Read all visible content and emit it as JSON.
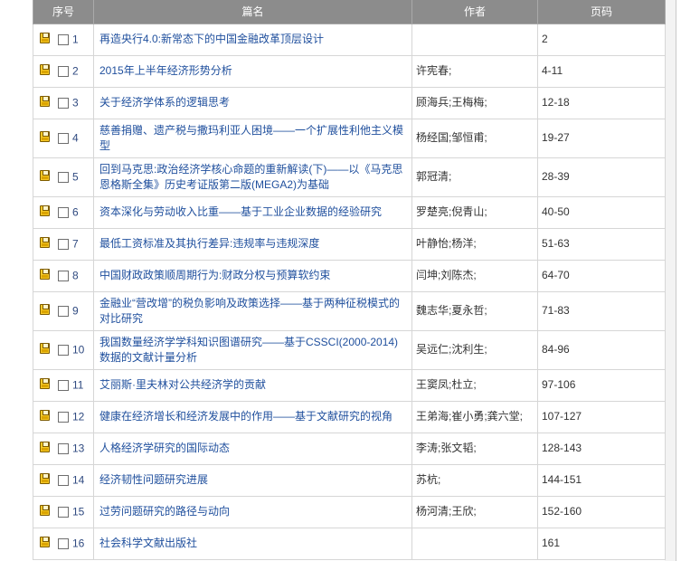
{
  "table": {
    "headers": {
      "index": "序号",
      "title": "篇名",
      "authors": "作者",
      "pages": "页码"
    },
    "rows": [
      {
        "index": "1",
        "checked": false,
        "title": "再造央行4.0:新常态下的中国金融改革顶层设计",
        "authors": "",
        "pages": "2"
      },
      {
        "index": "2",
        "checked": false,
        "title": "2015年上半年经济形势分析",
        "authors": "许宪春;",
        "pages": "4-11"
      },
      {
        "index": "3",
        "checked": false,
        "title": "关于经济学体系的逻辑思考",
        "authors": "顾海兵;王梅梅;",
        "pages": "12-18"
      },
      {
        "index": "4",
        "checked": false,
        "title": "慈善捐赠、遗产税与撒玛利亚人困境——一个扩展性利他主义模型",
        "authors": "杨经国;邹恒甫;",
        "pages": "19-27"
      },
      {
        "index": "5",
        "checked": false,
        "title": "回到马克思:政治经济学核心命题的重新解读(下)——以《马克思恩格斯全集》历史考证版第二版(MEGA2)为基础",
        "authors": "郭冠清;",
        "pages": "28-39"
      },
      {
        "index": "6",
        "checked": false,
        "title": "资本深化与劳动收入比重——基于工业企业数据的经验研究",
        "authors": "罗楚亮;倪青山;",
        "pages": "40-50"
      },
      {
        "index": "7",
        "checked": false,
        "title": "最低工资标准及其执行差异:违规率与违规深度",
        "authors": "叶静怡;杨洋;",
        "pages": "51-63"
      },
      {
        "index": "8",
        "checked": false,
        "title": "中国财政政策顺周期行为:财政分权与预算软约束",
        "authors": "闫坤;刘陈杰;",
        "pages": "64-70"
      },
      {
        "index": "9",
        "checked": false,
        "title": "金融业“营改增”的税负影响及政策选择——基于两种征税模式的对比研究",
        "authors": "魏志华;夏永哲;",
        "pages": "71-83"
      },
      {
        "index": "10",
        "checked": false,
        "title": "我国数量经济学学科知识图谱研究——基于CSSCI(2000-2014)数据的文献计量分析",
        "authors": "吴远仁;沈利生;",
        "pages": "84-96"
      },
      {
        "index": "11",
        "checked": false,
        "title": "艾丽斯·里夫林对公共经济学的贡献",
        "authors": "王窦凤;杜立;",
        "pages": "97-106"
      },
      {
        "index": "12",
        "checked": false,
        "title": "健康在经济增长和经济发展中的作用——基于文献研究的视角",
        "authors": "王弟海;崔小勇;龚六堂;",
        "pages": "107-127"
      },
      {
        "index": "13",
        "checked": false,
        "title": "人格经济学研究的国际动态",
        "authors": "李涛;张文韬;",
        "pages": "128-143"
      },
      {
        "index": "14",
        "checked": false,
        "title": "经济韧性问题研究进展",
        "authors": "苏杭;",
        "pages": "144-151"
      },
      {
        "index": "15",
        "checked": false,
        "title": "过劳问题研究的路径与动向",
        "authors": "杨河清;王欣;",
        "pages": "152-160"
      },
      {
        "index": "16",
        "checked": false,
        "title": "社会科学文献出版社",
        "authors": "",
        "pages": "161"
      }
    ]
  },
  "icons": {
    "row_icon": "note-icon"
  },
  "colors": {
    "header_bg": "#8c8c8c",
    "header_text": "#ffffff",
    "link": "#1f4f9d",
    "index_text": "#2f4a80",
    "border": "#d6d6d6",
    "icon_fill": "#f6c928"
  }
}
